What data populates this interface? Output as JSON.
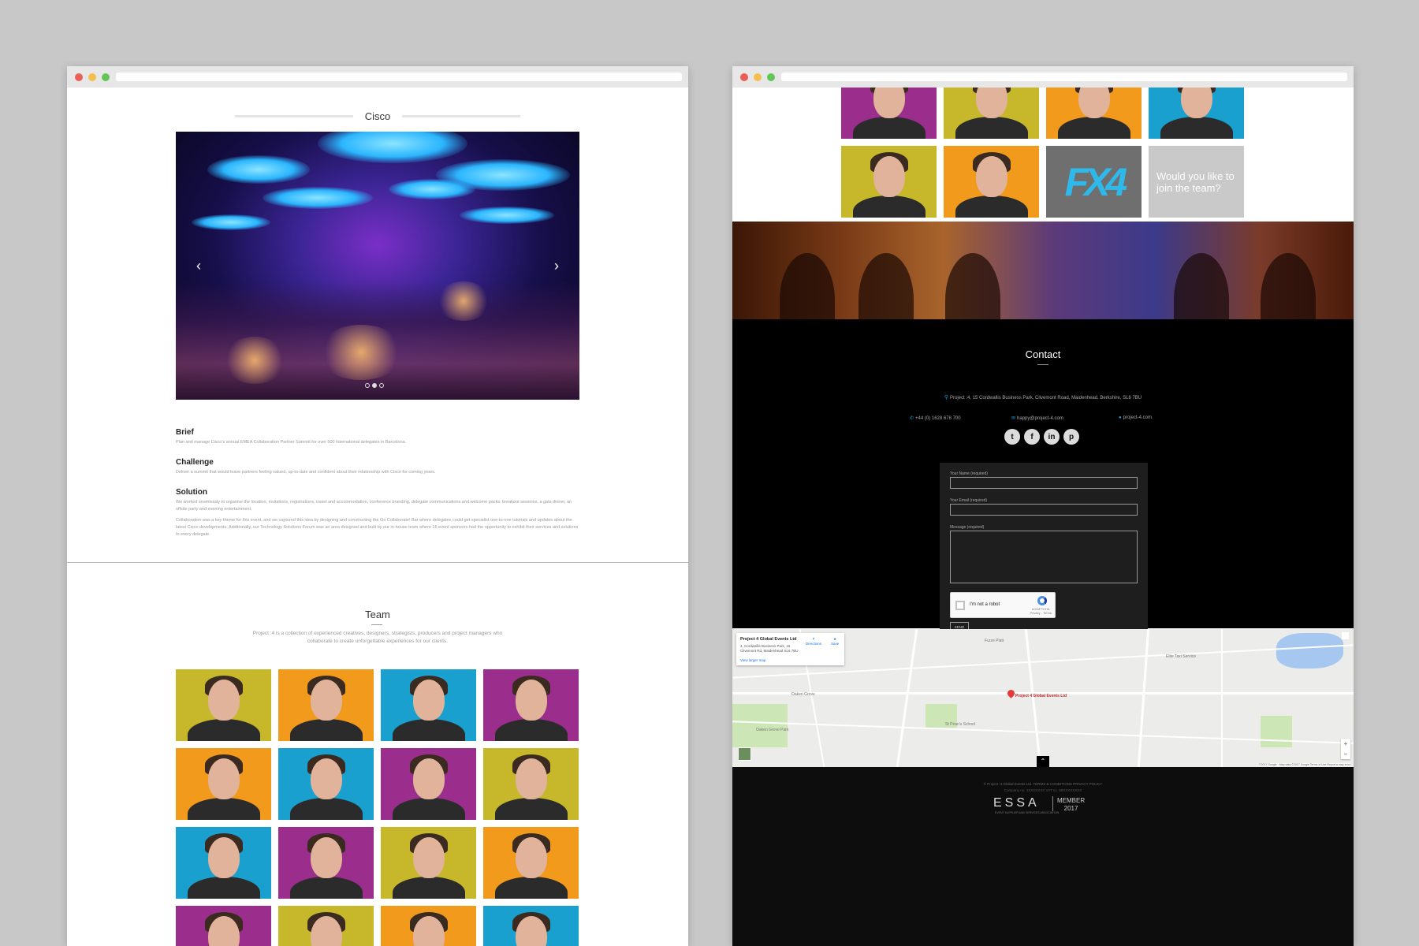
{
  "left_page": {
    "case_title": "Cisco",
    "sections": [
      {
        "heading": "Brief",
        "paragraphs": [
          "Plan and manage Cisco's annual EMEA Collaboration Partner Summit for over 500 international delegates in Barcelona."
        ]
      },
      {
        "heading": "Challenge",
        "paragraphs": [
          "Deliver a summit that would leave partners feeling valued, up-to-date and confident about their relationship with Cisco for coming years."
        ]
      },
      {
        "heading": "Solution",
        "paragraphs": [
          "We worked seamlessly to organise the location, invitations, registrations, travel and accommodation, conference branding, delegate communications and welcome packs, breakout sessions, a gala dinner, an offsite party and evening entertainment.",
          "Collaboration was a key theme for this event, and we captured this idea by designing and constructing the Go Collaborate! Bar where delegates could get specialist one-to-one tutorials and updates about the latest Cisco developments. Additionally, our Technology Solutions Forum was an area designed and built by our in-house team where 15 event sponsors had the opportunity to exhibit their services and solutions to every delegate."
        ]
      }
    ],
    "team": {
      "title": "Team",
      "intro": "Project :4 is a collection of experienced creatives, designers, strategists, producers and project managers who collaborate to create unforgettable experiences for our clients.",
      "tile_colors": [
        "#c6b82a",
        "#f29a1c",
        "#1aa0cf",
        "#9b2d8c",
        "#f29a1c",
        "#1aa0cf",
        "#9b2d8c",
        "#c6b82a",
        "#1aa0cf",
        "#9b2d8c",
        "#c6b82a",
        "#f29a1c",
        "#9b2d8c",
        "#c6b82a",
        "#f29a1c",
        "#1aa0cf"
      ]
    }
  },
  "right_page": {
    "team_tiles_top_colors": [
      "#9b2d8c",
      "#c6b82a",
      "#f29a1c",
      "#1aa0cf"
    ],
    "team_tiles_row2": [
      {
        "color": "#c6b82a"
      },
      {
        "color": "#f29a1c"
      },
      {
        "logo_text": "FX4"
      },
      {
        "join_text": "Would you like to join the team?"
      }
    ],
    "contact": {
      "title": "Contact",
      "address": "Project :4, 15 Cordwallis Business Park, Clivemont Road, Maidenhead, Berkshire, SL6 7BU",
      "phone": "+44 (0) 1628 678 700",
      "email": "happy@project-4.com",
      "website": "project-4.com",
      "socials": [
        "twitter-icon",
        "facebook-icon",
        "linkedin-icon",
        "pinterest-icon"
      ],
      "form": {
        "name_label": "Your Name (required)",
        "email_label": "Your Email (required)",
        "message_label": "Message (required)",
        "captcha_label": "I'm not a robot",
        "captcha_brand": "reCAPTCHA",
        "captcha_links": "Privacy - Terms",
        "send_label": "SEND"
      }
    },
    "map": {
      "place_name": "Project 4 Global Events Ltd",
      "place_address": "4, Cordwallis Business Park, 15 Clivemont Rd, Maidenhead SL6 7BU",
      "view_larger": "View larger map",
      "directions": "Directions",
      "save": "Save",
      "marker_label": "Project 4 Global Events Ltd",
      "labels": [
        "St Piran's School",
        "Oaken Grove Park",
        "Oaken Grove",
        "Elite Taxi Service",
        "Furze Platt"
      ],
      "attribution": "©2017 Google · Map data ©2017 Google   Terms of Use   Report a map error"
    },
    "footer": {
      "copyright": "© Project :4 Global Events Ltd.  TERMS & CONDITIONS  PRIVACY POLICY",
      "company": "Company no. 4XXXXXXX  VAT no. 58XXXXXXXX",
      "essa": "ESSA",
      "essa_sub": "EVENT SUPPLIER AND SERVICES ASSOCIATION",
      "member": "MEMBER",
      "member_year": "2017"
    }
  }
}
